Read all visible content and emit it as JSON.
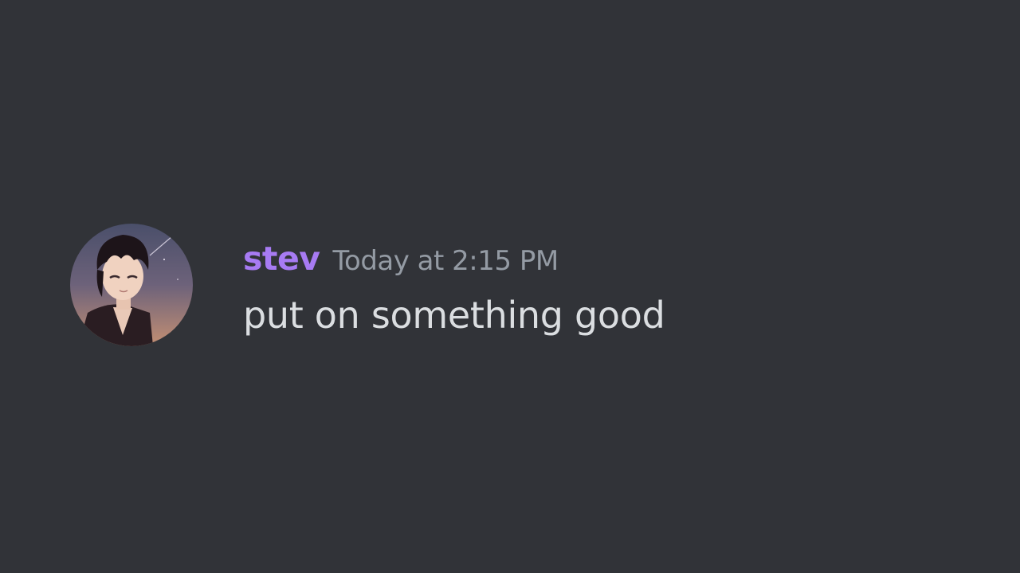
{
  "message": {
    "author": {
      "username": "stev",
      "color": "#a77bf3",
      "avatar_icon": "user-avatar"
    },
    "timestamp": "Today at 2:15 PM",
    "content": "put on something good"
  },
  "theme": {
    "background": "#313338",
    "text": "#dbdee1",
    "muted": "#949ba4"
  }
}
